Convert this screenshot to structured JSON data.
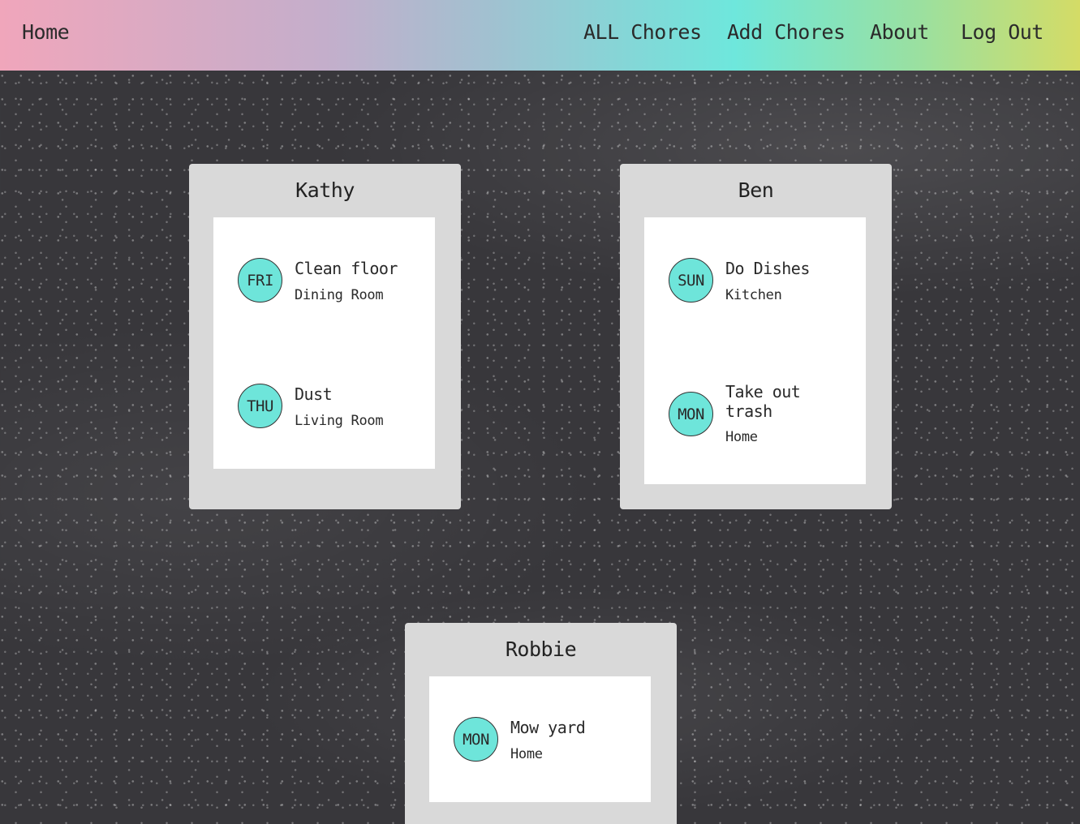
{
  "nav": {
    "home": "Home",
    "all_chores": "ALL Chores",
    "add_chores": "Add Chores",
    "about": "About",
    "log_out": "Log Out"
  },
  "colors": {
    "badge": "#6ee5da",
    "card": "#d9d9d9",
    "navbar_gradient": [
      "#f0a6bb",
      "#a2c0d0",
      "#6ee7dc",
      "#d4dc66"
    ]
  },
  "people": [
    {
      "name": "Kathy",
      "chores": [
        {
          "day": "FRI",
          "task": "Clean floor",
          "room": "Dining Room"
        },
        {
          "day": "THU",
          "task": "Dust",
          "room": "Living Room"
        }
      ]
    },
    {
      "name": "Ben",
      "chores": [
        {
          "day": "SUN",
          "task": "Do Dishes",
          "room": "Kitchen"
        },
        {
          "day": "MON",
          "task": "Take out trash",
          "room": "Home"
        }
      ]
    },
    {
      "name": "Robbie",
      "chores": [
        {
          "day": "MON",
          "task": "Mow yard",
          "room": "Home"
        }
      ]
    }
  ]
}
